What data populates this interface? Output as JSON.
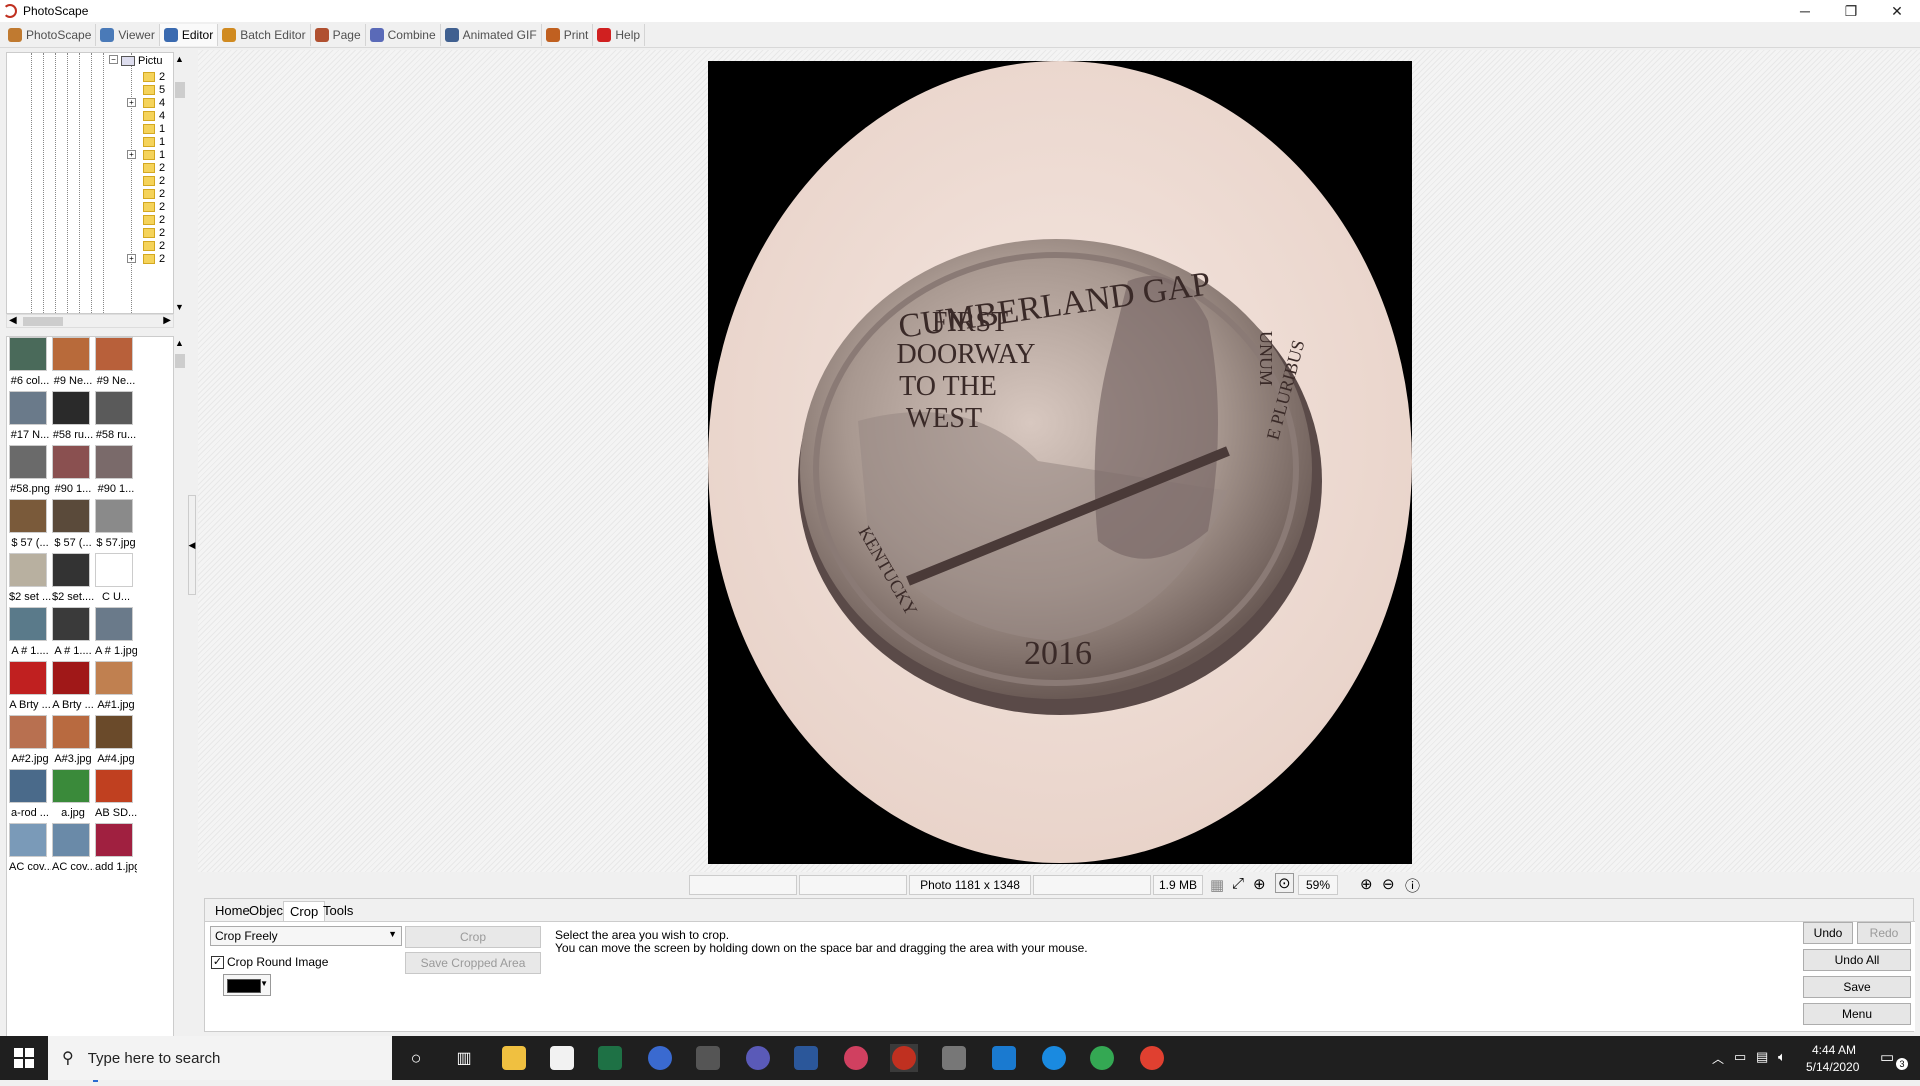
{
  "window": {
    "title": "PhotoScape",
    "minimize": "─",
    "restore": "❐",
    "close": "✕"
  },
  "main_tabs": [
    {
      "label": "PhotoScape",
      "color": "#c07a30"
    },
    {
      "label": "Viewer",
      "color": "#4a7ab8"
    },
    {
      "label": "Editor",
      "color": "#3a6ab0"
    },
    {
      "label": "Batch Editor",
      "color": "#d08a20"
    },
    {
      "label": "Page",
      "color": "#b05030"
    },
    {
      "label": "Combine",
      "color": "#5a6ab8"
    },
    {
      "label": "Animated GIF",
      "color": "#406090"
    },
    {
      "label": "Print",
      "color": "#c06020"
    },
    {
      "label": "Help",
      "color": "#d02020"
    }
  ],
  "tree": {
    "root_label": "Pictu",
    "rows": [
      "2",
      "5",
      "4",
      "4",
      "1",
      "1",
      "1",
      "2",
      "2",
      "2",
      "2",
      "2",
      "2",
      "2",
      "2"
    ]
  },
  "thumbnails": [
    {
      "label": "#6 col...",
      "color": "#4a6a5a"
    },
    {
      "label": "#9 Ne...",
      "color": "#b86a3a"
    },
    {
      "label": "#9 Ne...",
      "color": "#b8603a"
    },
    {
      "label": "#17 N...",
      "color": "#6a7a8a"
    },
    {
      "label": "#58 ru...",
      "color": "#2a2a2a"
    },
    {
      "label": "#58 ru...",
      "color": "#5a5a5a"
    },
    {
      "label": "#58.png",
      "color": "#6a6a6a"
    },
    {
      "label": "#90 1...",
      "color": "#8a5050"
    },
    {
      "label": "#90 1...",
      "color": "#7a6a6a"
    },
    {
      "label": "$ 57 (...",
      "color": "#7a5a3a"
    },
    {
      "label": "$ 57 (...",
      "color": "#5a4a3a"
    },
    {
      "label": "$ 57.jpg",
      "color": "#8a8a8a"
    },
    {
      "label": "$2 set ...",
      "color": "#b8b0a0"
    },
    {
      "label": "$2 set....",
      "color": "#333333"
    },
    {
      "label": "C   U...",
      "color": "#ffffff"
    },
    {
      "label": "A # 1....",
      "color": "#5a7a8a"
    },
    {
      "label": "A # 1....",
      "color": "#3a3a3a"
    },
    {
      "label": "A # 1.jpg",
      "color": "#6a7a8a"
    },
    {
      "label": "A Brty ...",
      "color": "#c02020"
    },
    {
      "label": "A Brty ...",
      "color": "#a01818"
    },
    {
      "label": "A#1.jpg",
      "color": "#c08050"
    },
    {
      "label": "A#2.jpg",
      "color": "#b87050"
    },
    {
      "label": "A#3.jpg",
      "color": "#b86a40"
    },
    {
      "label": "A#4.jpg",
      "color": "#6a4a2a"
    },
    {
      "label": "a-rod ...",
      "color": "#4a6a8a"
    },
    {
      "label": "a.jpg",
      "color": "#3a8a3a"
    },
    {
      "label": "AB SD....",
      "color": "#c04020"
    },
    {
      "label": "AC cov...",
      "color": "#7a9ab8"
    },
    {
      "label": "AC cov...",
      "color": "#6a8aa8"
    },
    {
      "label": "add 1.jpg",
      "color": "#a02040"
    }
  ],
  "status": {
    "photo_info": "Photo 1181 x 1348",
    "file_size": "1.9 MB",
    "zoom": "59%"
  },
  "sub_tabs": [
    "Home",
    "Object",
    "Crop",
    "Tools"
  ],
  "crop": {
    "mode": "Crop Freely",
    "crop_button": "Crop",
    "save_cropped_button": "Save Cropped Area",
    "round_label": "Crop Round Image",
    "round_checked": "✓",
    "hint_line1": "Select the area you wish to crop.",
    "hint_line2": "You can move the screen by holding down on the space bar and dragging the area with your mouse.",
    "round_color": "#000000"
  },
  "right_buttons": {
    "undo": "Undo",
    "redo": "Redo",
    "undo_all": "Undo All",
    "save": "Save",
    "menu": "Menu"
  },
  "coin": {
    "top_text": "CUMBERLAND GAP",
    "line1": "FIRST",
    "line2": "DOORWAY",
    "line3": "TO THE",
    "line4": "WEST",
    "left_text": "KENTUCKY",
    "right_text": "UNUM",
    "right_text2": "E PLURIBUS",
    "year": "2016"
  },
  "taskbar": {
    "search_placeholder": "Type here to search",
    "time": "4:44 AM",
    "date": "5/14/2020",
    "notification_count": "3"
  }
}
